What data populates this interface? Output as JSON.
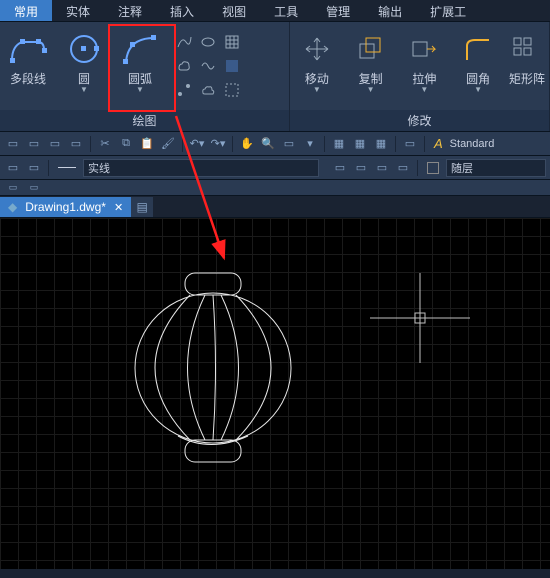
{
  "menu": {
    "tabs": [
      "常用",
      "实体",
      "注释",
      "插入",
      "视图",
      "工具",
      "管理",
      "输出",
      "扩展工"
    ]
  },
  "ribbon": {
    "draw": {
      "title": "绘图",
      "tools": [
        {
          "name": "polyline",
          "label": "多段线"
        },
        {
          "name": "circle",
          "label": "圆"
        },
        {
          "name": "arc",
          "label": "圆弧"
        }
      ]
    },
    "modify": {
      "title": "修改",
      "tools": [
        {
          "name": "move",
          "label": "移动"
        },
        {
          "name": "copy",
          "label": "复制"
        },
        {
          "name": "stretch",
          "label": "拉伸"
        },
        {
          "name": "fillet",
          "label": "圆角"
        },
        {
          "name": "rect-array",
          "label": "矩形阵"
        }
      ]
    }
  },
  "toolbar2": {
    "linetype": "实线",
    "layer": "随层",
    "textstyle": "Standard"
  },
  "document": {
    "tab": "Drawing1.dwg*"
  }
}
